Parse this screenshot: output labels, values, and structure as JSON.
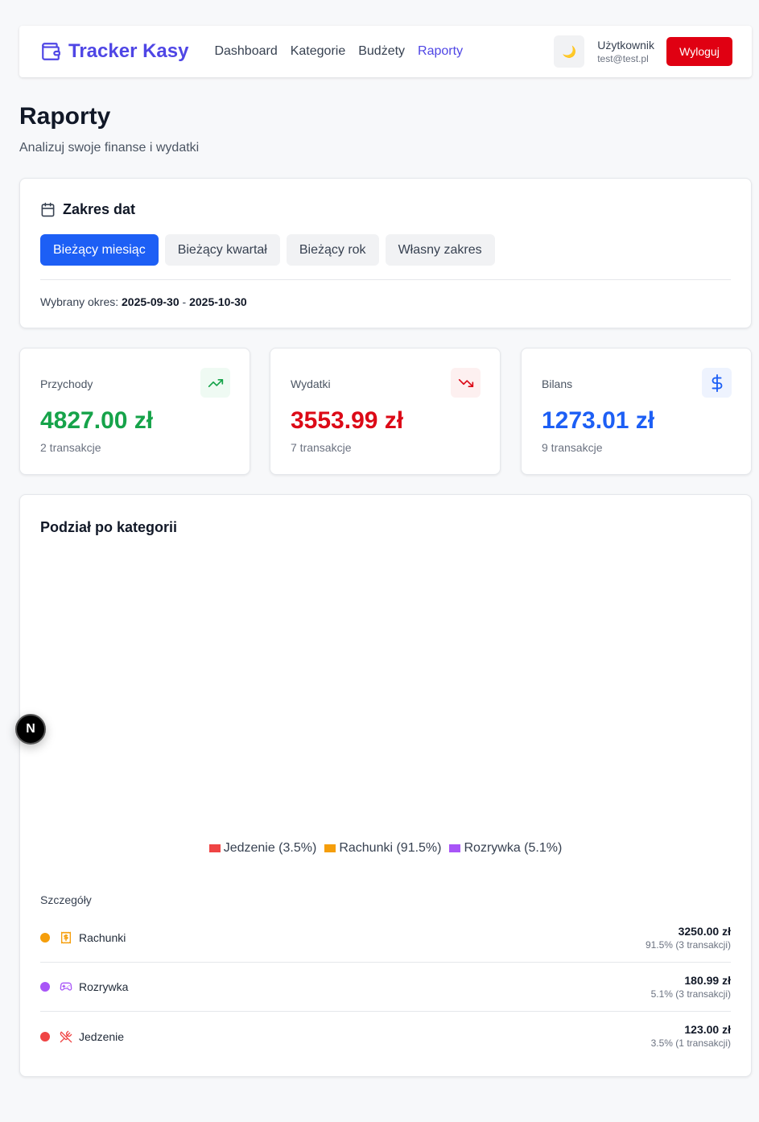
{
  "brand": {
    "name": "Tracker Kasy",
    "icon": "wallet-icon",
    "color": "#4f46e5"
  },
  "nav": {
    "links": [
      {
        "label": "Dashboard",
        "active": false
      },
      {
        "label": "Kategorie",
        "active": false
      },
      {
        "label": "Budżety",
        "active": false
      },
      {
        "label": "Raporty",
        "active": true
      }
    ],
    "theme_icon": "🌙",
    "user_name": "Użytkownik",
    "user_email": "test@test.pl",
    "logout_label": "Wyloguj"
  },
  "header": {
    "title": "Raporty",
    "subtitle": "Analizuj swoje finanse i wydatki"
  },
  "date_range": {
    "heading": "Zakres dat",
    "buttons": [
      {
        "label": "Bieżący miesiąc",
        "active": true
      },
      {
        "label": "Bieżący kwartał",
        "active": false
      },
      {
        "label": "Bieżący rok",
        "active": false
      },
      {
        "label": "Własny zakres",
        "active": false
      }
    ],
    "period_label": "Wybrany okres:",
    "period_start": "2025-09-30",
    "period_separator": "-",
    "period_end": "2025-10-30"
  },
  "stats": [
    {
      "label": "Przychody",
      "value": "4827.00 zł",
      "count": "2 transakcje",
      "color": "#16a34a",
      "icon_bg": "#effaf3",
      "icon": "trending-up-icon"
    },
    {
      "label": "Wydatki",
      "value": "3553.99 zł",
      "count": "7 transakcje",
      "color": "#dc0a17",
      "icon_bg": "#fdf0f0",
      "icon": "trending-down-icon"
    },
    {
      "label": "Bilans",
      "value": "1273.01 zł",
      "count": "9 transakcje",
      "color": "#1d5ff5",
      "icon_bg": "#eef3fe",
      "icon": "dollar-icon"
    }
  ],
  "category": {
    "title": "Podział po kategorii",
    "legend": [
      {
        "label": "Jedzenie (3.5%)",
        "color": "#ef4444"
      },
      {
        "label": "Rachunki (91.5%)",
        "color": "#f59e0b"
      },
      {
        "label": "Rozrywka (5.1%)",
        "color": "#a855f7"
      }
    ],
    "details_title": "Szczegóły",
    "rows": [
      {
        "name": "Rachunki",
        "amount": "3250.00 zł",
        "meta": "91.5% (3 transakcji)",
        "color": "#f59e0b",
        "icon": "bill-icon"
      },
      {
        "name": "Rozrywka",
        "amount": "180.99 zł",
        "meta": "5.1% (3 transakcji)",
        "color": "#a855f7",
        "icon": "gamepad-icon"
      },
      {
        "name": "Jedzenie",
        "amount": "123.00 zł",
        "meta": "3.5% (1 transakcji)",
        "color": "#ef4444",
        "icon": "utensils-icon"
      }
    ]
  },
  "fab_label": "N"
}
